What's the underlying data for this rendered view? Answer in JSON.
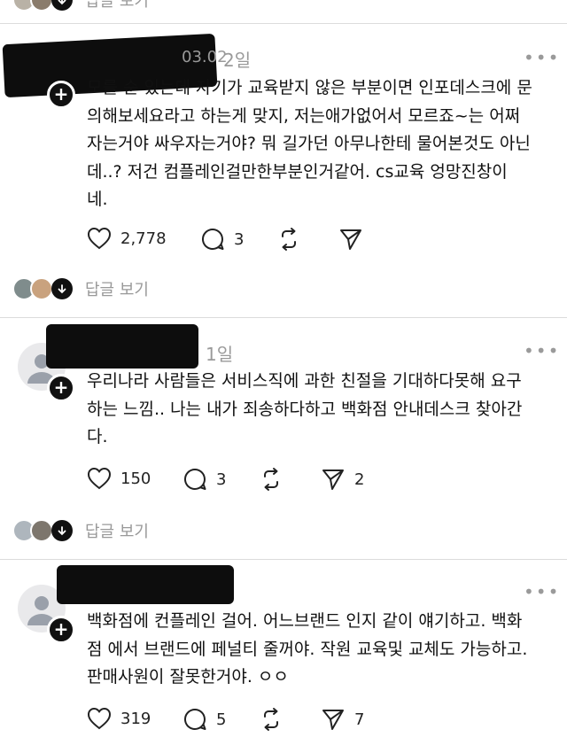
{
  "top_partial": {
    "reply_label": "답글 보기"
  },
  "posts": [
    {
      "time": "2일",
      "partial_name": "03.02",
      "text": "모를 순 있는데 자기가 교육받지 않은 부분이면 인포데스크에 문\n의해보세요라고 하는게 맞지, 저는애가없어서 모르죠~는 어쩌\n자는거야 싸우자는거야? 뭐 길가던 아무나한테 물어본것도 아닌\n데..? 저건 컴플레인걸만한부분인거같어. cs교육 엉망진창이\n네.",
      "likes": "2,778",
      "comments": "3",
      "reposts": "",
      "shares": "",
      "reply_label": "답글 보기"
    },
    {
      "time": "1일",
      "text": "우리나라 사람들은 서비스직에 과한 친절을 기대하다못해 요구\n하는 느낌.. 나는 내가  죄송하다하고 백화점 안내데스크 찾아간\n다.",
      "likes": "150",
      "comments": "3",
      "reposts": "",
      "shares": "2",
      "reply_label": "답글 보기"
    },
    {
      "time": "",
      "text": "백화점에 컨플레인 걸어. 어느브랜드 인지 같이 얘기하고. 백화\n점 에서 브랜드에 페널티 줄꺼야. 작원 교육및 교체도 가능하고.\n판매사원이 잘못한거야. ㅇㅇ",
      "likes": "319",
      "comments": "5",
      "reposts": "",
      "shares": "7"
    }
  ],
  "icons": {
    "more": "more-icon",
    "like": "heart-icon",
    "comment": "comment-icon",
    "repost": "repost-icon",
    "share": "share-icon",
    "plus": "plus-icon",
    "chevron": "chevron-down-icon"
  },
  "colors": {
    "text": "#111111",
    "muted": "#9a9a9a",
    "divider": "#dcdcdc"
  }
}
